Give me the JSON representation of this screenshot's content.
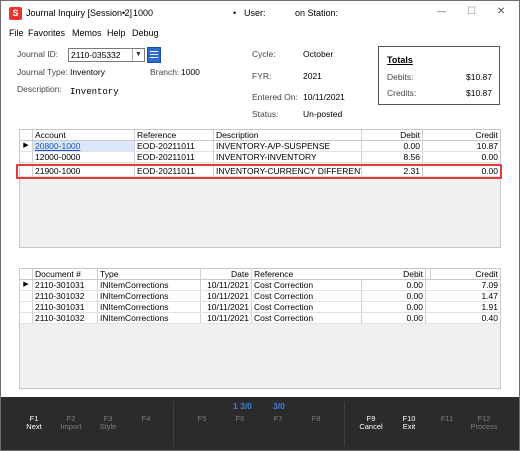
{
  "window": {
    "icon_letter": "S",
    "title": "Journal Inquiry [Session 2]",
    "bullet": "•",
    "title_num": "1000",
    "user_label": "User:",
    "station_label": "on Station:",
    "minimize": "—",
    "maximize": "☐",
    "close": "✕"
  },
  "menu": [
    "File",
    "Favorites",
    "Memos",
    "Help",
    "Debug"
  ],
  "header": {
    "journal_id_label": "Journal ID:",
    "journal_id_value": "2110-035332",
    "journal_type_label": "Journal Type:",
    "journal_type_value": "Inventory",
    "branch_label": "Branch:",
    "branch_value": "1000",
    "description_label": "Description:",
    "description_value": "Inventory",
    "cycle_label": "Cycle:",
    "cycle_value": "October",
    "fyr_label": "FYR:",
    "fyr_value": "2021",
    "entered_label": "Entered On:",
    "entered_value": "10/11/2021",
    "status_label": "Status:",
    "status_value": "Un-posted"
  },
  "totals": {
    "title": "Totals",
    "debits_label": "Debits:",
    "debits_value": "$10.87",
    "credits_label": "Credits:",
    "credits_value": "$10.87"
  },
  "grid1": {
    "headers": [
      "Account",
      "Reference",
      "Description",
      "Debit",
      "Credit"
    ],
    "rows": [
      [
        "20800-1000",
        "EOD-20211011",
        "INVENTORY-A/P-SUSPENSE",
        "0.00",
        "10.87"
      ],
      [
        "12000-0000",
        "EOD-20211011",
        "INVENTORY-INVENTORY",
        "8.56",
        "0.00"
      ],
      [
        "21900-1000",
        "EOD-20211011",
        "INVENTORY-CURRENCY DIFFERENTIA",
        "2.31",
        "0.00"
      ]
    ]
  },
  "grid2": {
    "headers": [
      "Document #",
      "Type",
      "Date",
      "Reference",
      "Debit",
      "Credit"
    ],
    "rows": [
      [
        "2110-301031",
        "INItemCorrections",
        "10/11/2021",
        "Cost Correction",
        "0.00",
        "7.09"
      ],
      [
        "2110-301032",
        "INItemCorrections",
        "10/11/2021",
        "Cost Correction",
        "0.00",
        "1.47"
      ],
      [
        "2110-301031",
        "INItemCorrections",
        "10/11/2021",
        "Cost Correction",
        "0.00",
        "1.91"
      ],
      [
        "2110-301032",
        "INItemCorrections",
        "10/11/2021",
        "Cost Correction",
        "0.00",
        "0.40"
      ]
    ]
  },
  "footer": {
    "page_a": "1  3/0",
    "page_b": "3/0",
    "keys": [
      {
        "key": "F1",
        "label": "Next"
      },
      {
        "key": "F2",
        "label": "Import"
      },
      {
        "key": "F3",
        "label": "Style"
      },
      {
        "key": "F4",
        "label": ""
      },
      {
        "key": "F5",
        "label": ""
      },
      {
        "key": "F6",
        "label": ""
      },
      {
        "key": "F7",
        "label": ""
      },
      {
        "key": "F8",
        "label": ""
      },
      {
        "key": "F9",
        "label": "Cancel"
      },
      {
        "key": "F10",
        "label": "Exit"
      },
      {
        "key": "F11",
        "label": ""
      },
      {
        "key": "F12",
        "label": "Process"
      }
    ]
  }
}
